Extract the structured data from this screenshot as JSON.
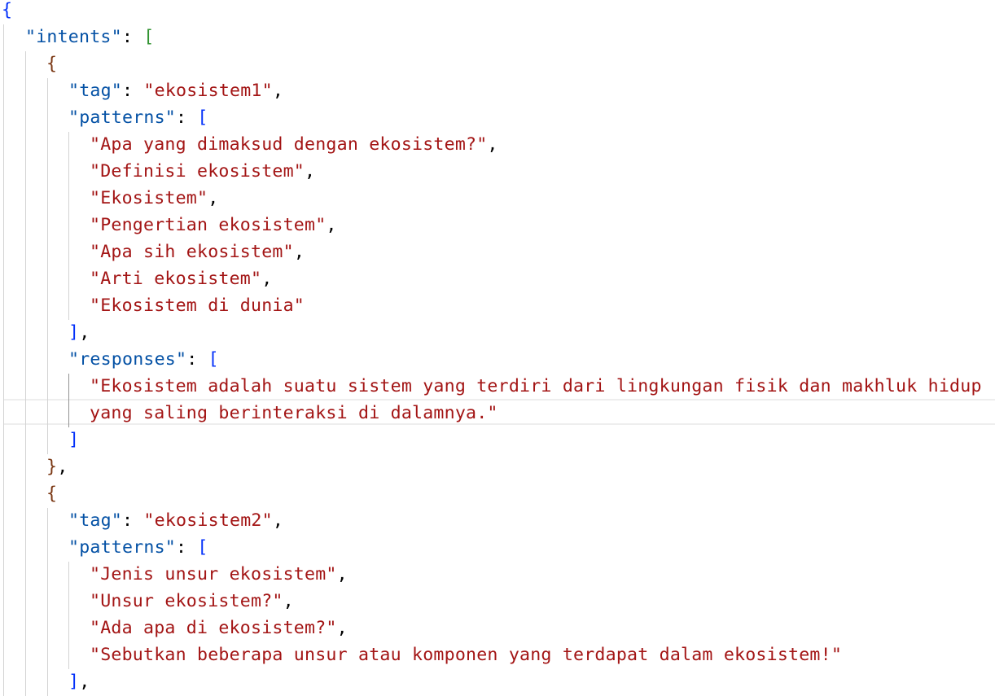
{
  "editor": {
    "intents_key": "\"intents\"",
    "items": [
      {
        "tag_key": "\"tag\"",
        "tag_value": "\"ekosistem1\"",
        "patterns_key": "\"patterns\"",
        "patterns": [
          "\"Apa yang dimaksud dengan ekosistem?\"",
          "\"Definisi ekosistem\"",
          "\"Ekosistem\"",
          "\"Pengertian ekosistem\"",
          "\"Apa sih ekosistem\"",
          "\"Arti ekosistem\"",
          "\"Ekosistem di dunia\""
        ],
        "responses_key": "\"responses\"",
        "responses_line1": "\"Ekosistem adalah suatu sistem yang terdiri dari lingkungan fisik dan makhluk hidup",
        "responses_line2": "yang saling berinteraksi di dalamnya.\""
      },
      {
        "tag_key": "\"tag\"",
        "tag_value": "\"ekosistem2\"",
        "patterns_key": "\"patterns\"",
        "patterns": [
          "\"Jenis unsur ekosistem\"",
          "\"Unsur ekosistem?\"",
          "\"Ada apa di ekosistem?\"",
          "\"Sebutkan beberapa unsur atau komponen yang terdapat dalam ekosistem!\""
        ]
      }
    ],
    "colors": {
      "key": "#0451a5",
      "string": "#a31515",
      "bracket_level1": "#0431fa",
      "bracket_level2": "#319331",
      "bracket_level3": "#7b3814",
      "indent_guide": "#d3d3d3",
      "active_indent_guide": "#939393"
    }
  }
}
